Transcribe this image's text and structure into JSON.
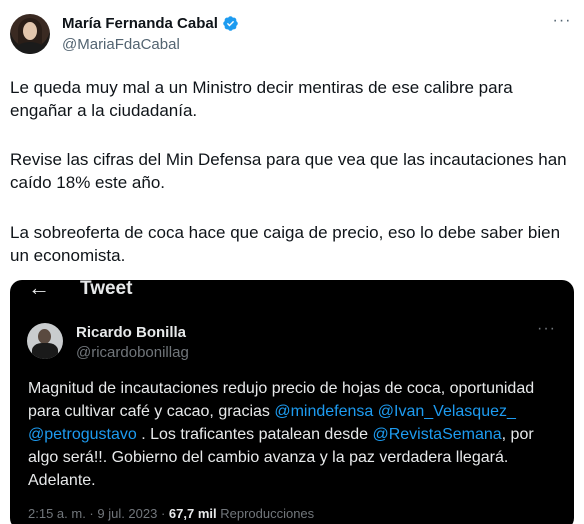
{
  "author": {
    "name": "María Fernanda Cabal",
    "handle": "@MariaFdaCabal"
  },
  "tweet": {
    "paragraph_1": "Le queda muy mal a un Ministro decir mentiras de ese calibre para engañar a la ciudadanía.",
    "paragraph_2": "Revise las cifras del Min Defensa para que vea que las incautaciones han caído 18% este año.",
    "paragraph_3": "La sobreoferta de coca hace que caiga de precio, eso lo debe saber bien un economista."
  },
  "embedded": {
    "header_title": "Tweet",
    "author_name": "Ricardo Bonilla",
    "author_handle": "@ricardobonillag",
    "text_1": "Magnitud de incautaciones redujo precio de hojas de coca, oportunidad para cultivar café y cacao, gracias ",
    "mention_1": "@mindefensa",
    "text_2": " ",
    "mention_2": "@Ivan_Velasquez_",
    "text_3": " ",
    "mention_3": "@petrogustavo",
    "text_4": " . Los traficantes patalean desde ",
    "mention_4": "@RevistaSemana",
    "text_5": ", por algo será!!. Gobierno del cambio avanza y la paz verdadera llegará. Adelante.",
    "timestamp": "2:15 a. m. · 9 jul. 2023 · ",
    "views_count": "67,7 mil",
    "views_label": " Reproducciones"
  },
  "colors": {
    "accent": "#1d9bf0",
    "embed_background": "#000000",
    "secondary_text": "#536471"
  },
  "icons": {
    "verified": "verified-badge-icon",
    "more": "more-options-icon",
    "back": "back-arrow-icon"
  }
}
